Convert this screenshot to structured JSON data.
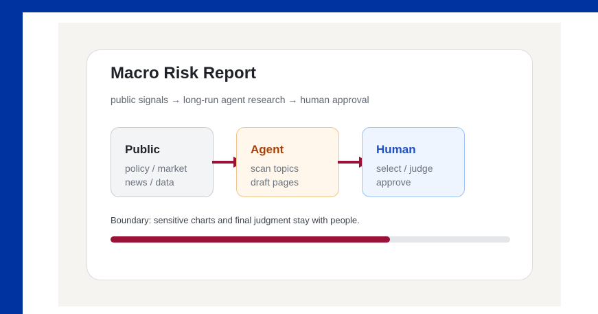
{
  "report": {
    "title": "Macro Risk Report",
    "subtitle": "public signals → long-run agent research → human approval"
  },
  "flow": {
    "nodes": [
      {
        "title": "Public",
        "lines": [
          "policy / market",
          "news / data"
        ]
      },
      {
        "title": "Agent",
        "lines": [
          "scan topics",
          "draft pages"
        ]
      },
      {
        "title": "Human",
        "lines": [
          "select / judge",
          "approve"
        ]
      }
    ],
    "arrow_color": "#9b1238"
  },
  "boundary": {
    "text": "Boundary: sensitive charts and final judgment stay with people.",
    "progress_fraction": 0.7
  },
  "colors": {
    "background": "#0033a0",
    "progress_fill": "#9b1238",
    "agent_accent": "#a5400c",
    "human_accent": "#1f4fc4"
  }
}
